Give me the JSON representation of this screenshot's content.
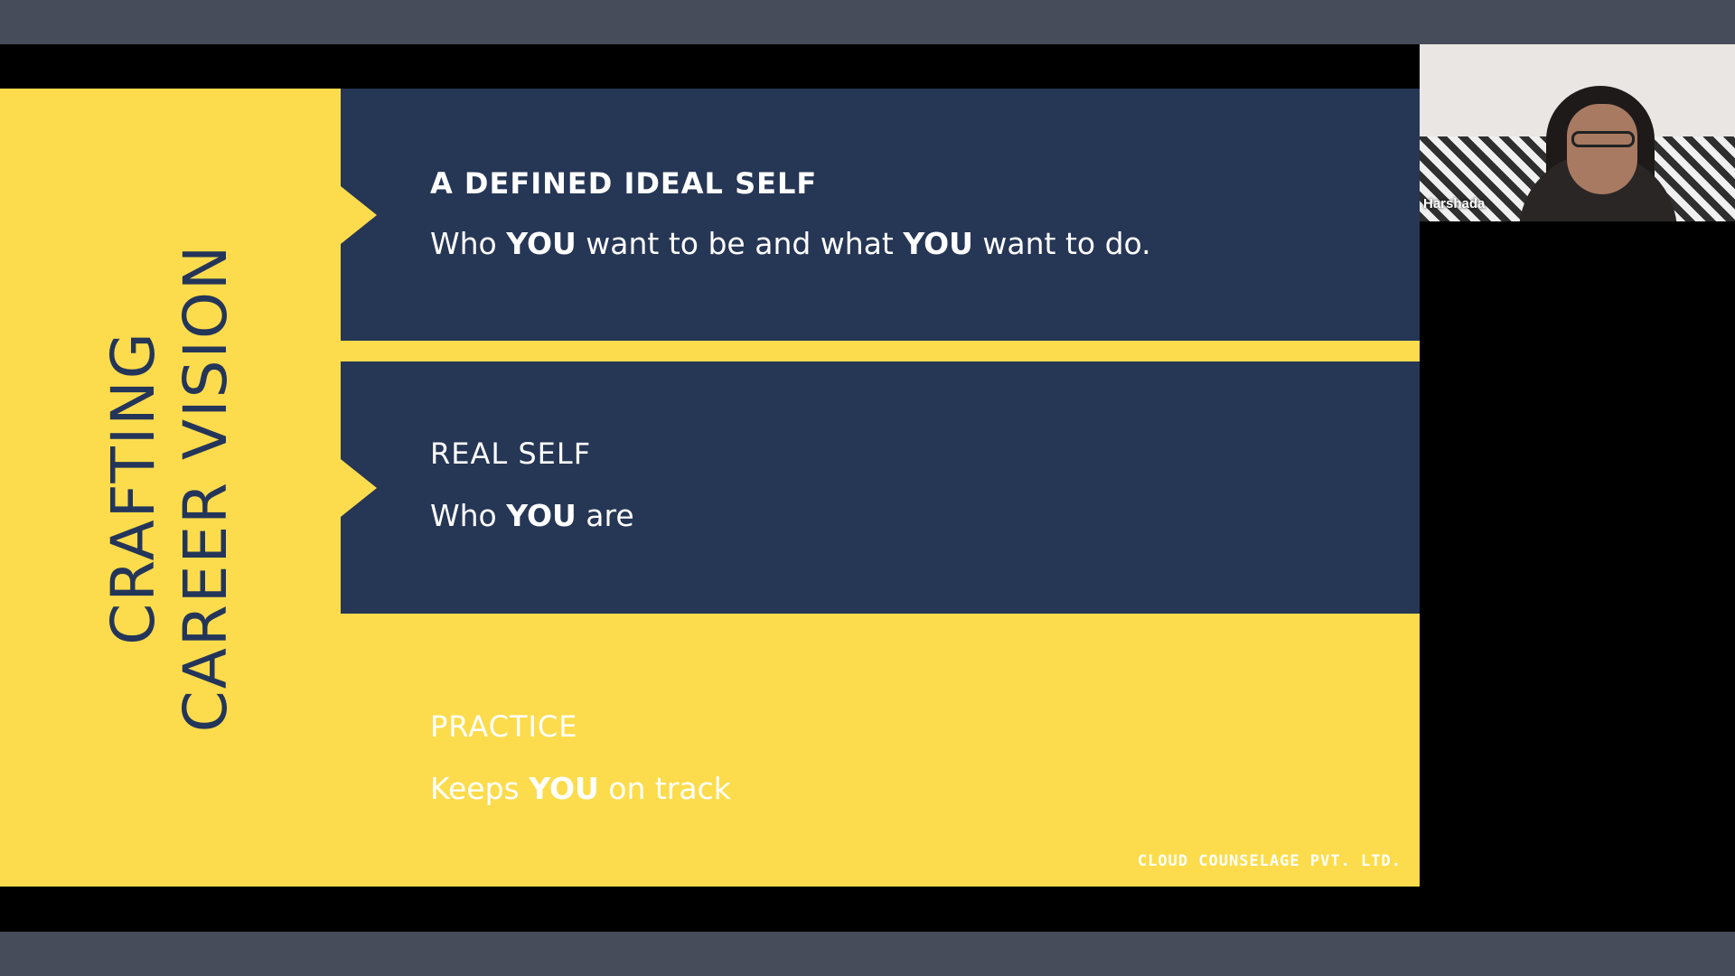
{
  "slide": {
    "side_title_line1": "CRAFTING",
    "side_title_line2": "CAREER VISION",
    "items": [
      {
        "heading": "A DEFINED IDEAL SELF",
        "text_parts": [
          "Who ",
          "YOU",
          " want to be and what ",
          "YOU",
          " want to do."
        ]
      },
      {
        "heading": "REAL SELF",
        "text_parts": [
          "Who ",
          "YOU",
          " are"
        ]
      },
      {
        "heading": "PRACTICE",
        "text_parts": [
          "Keeps ",
          "YOU",
          " on track"
        ]
      }
    ],
    "brand": "CLOUD COUNSELAGE PVT. LTD.",
    "colors": {
      "yellow": "#fcdc4c",
      "navy": "#263655",
      "title": "#24355a"
    }
  },
  "participant": {
    "name": "Harshada",
    "icon": "video-feed-icon"
  }
}
